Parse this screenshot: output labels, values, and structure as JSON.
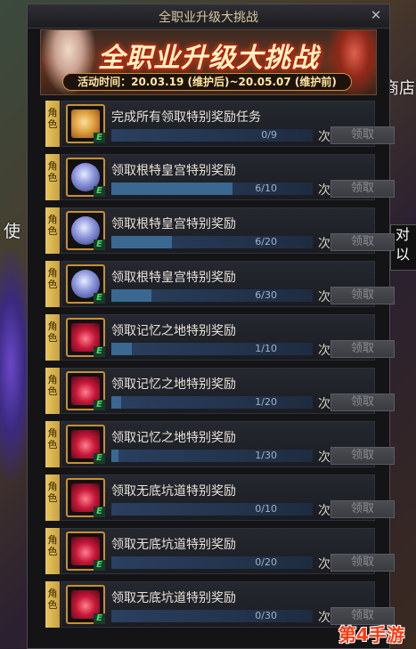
{
  "background": {
    "left_text": "使",
    "right_top_text": "商店",
    "right_box_lines": [
      "对",
      "以"
    ]
  },
  "watermark": "第4手游",
  "dialog": {
    "title": "全职业升级大挑战",
    "close_glyph": "✕",
    "banner_title": "全职业升级大挑战",
    "period": "活动时间：20.03.19 (维护后)~20.05.07 (维护前)"
  },
  "tab_label": [
    "角",
    "色"
  ],
  "badge_letter": "E",
  "unit_label": "次",
  "claim_label": "领取",
  "tasks": [
    {
      "name": "完成所有领取特别奖励任务",
      "progress": "0/9",
      "current": 0,
      "total": 9,
      "icon": "scroll-icon"
    },
    {
      "name": "领取根特皇宫特别奖励",
      "progress": "6/10",
      "current": 6,
      "total": 10,
      "icon": "coin-icon"
    },
    {
      "name": "领取根特皇宫特别奖励",
      "progress": "6/20",
      "current": 6,
      "total": 20,
      "icon": "coin-icon"
    },
    {
      "name": "领取根特皇宫特别奖励",
      "progress": "6/30",
      "current": 6,
      "total": 30,
      "icon": "coin-icon"
    },
    {
      "name": "领取记忆之地特别奖励",
      "progress": "1/10",
      "current": 1,
      "total": 10,
      "icon": "flame-icon"
    },
    {
      "name": "领取记忆之地特别奖励",
      "progress": "1/20",
      "current": 1,
      "total": 20,
      "icon": "flame-icon"
    },
    {
      "name": "领取记忆之地特别奖励",
      "progress": "1/30",
      "current": 1,
      "total": 30,
      "icon": "flame-icon"
    },
    {
      "name": "领取无底坑道特别奖励",
      "progress": "0/10",
      "current": 0,
      "total": 10,
      "icon": "flame-icon"
    },
    {
      "name": "领取无底坑道特别奖励",
      "progress": "0/20",
      "current": 0,
      "total": 20,
      "icon": "flame-icon"
    },
    {
      "name": "领取无底坑道特别奖励",
      "progress": "0/30",
      "current": 0,
      "total": 30,
      "icon": "flame-icon"
    }
  ]
}
